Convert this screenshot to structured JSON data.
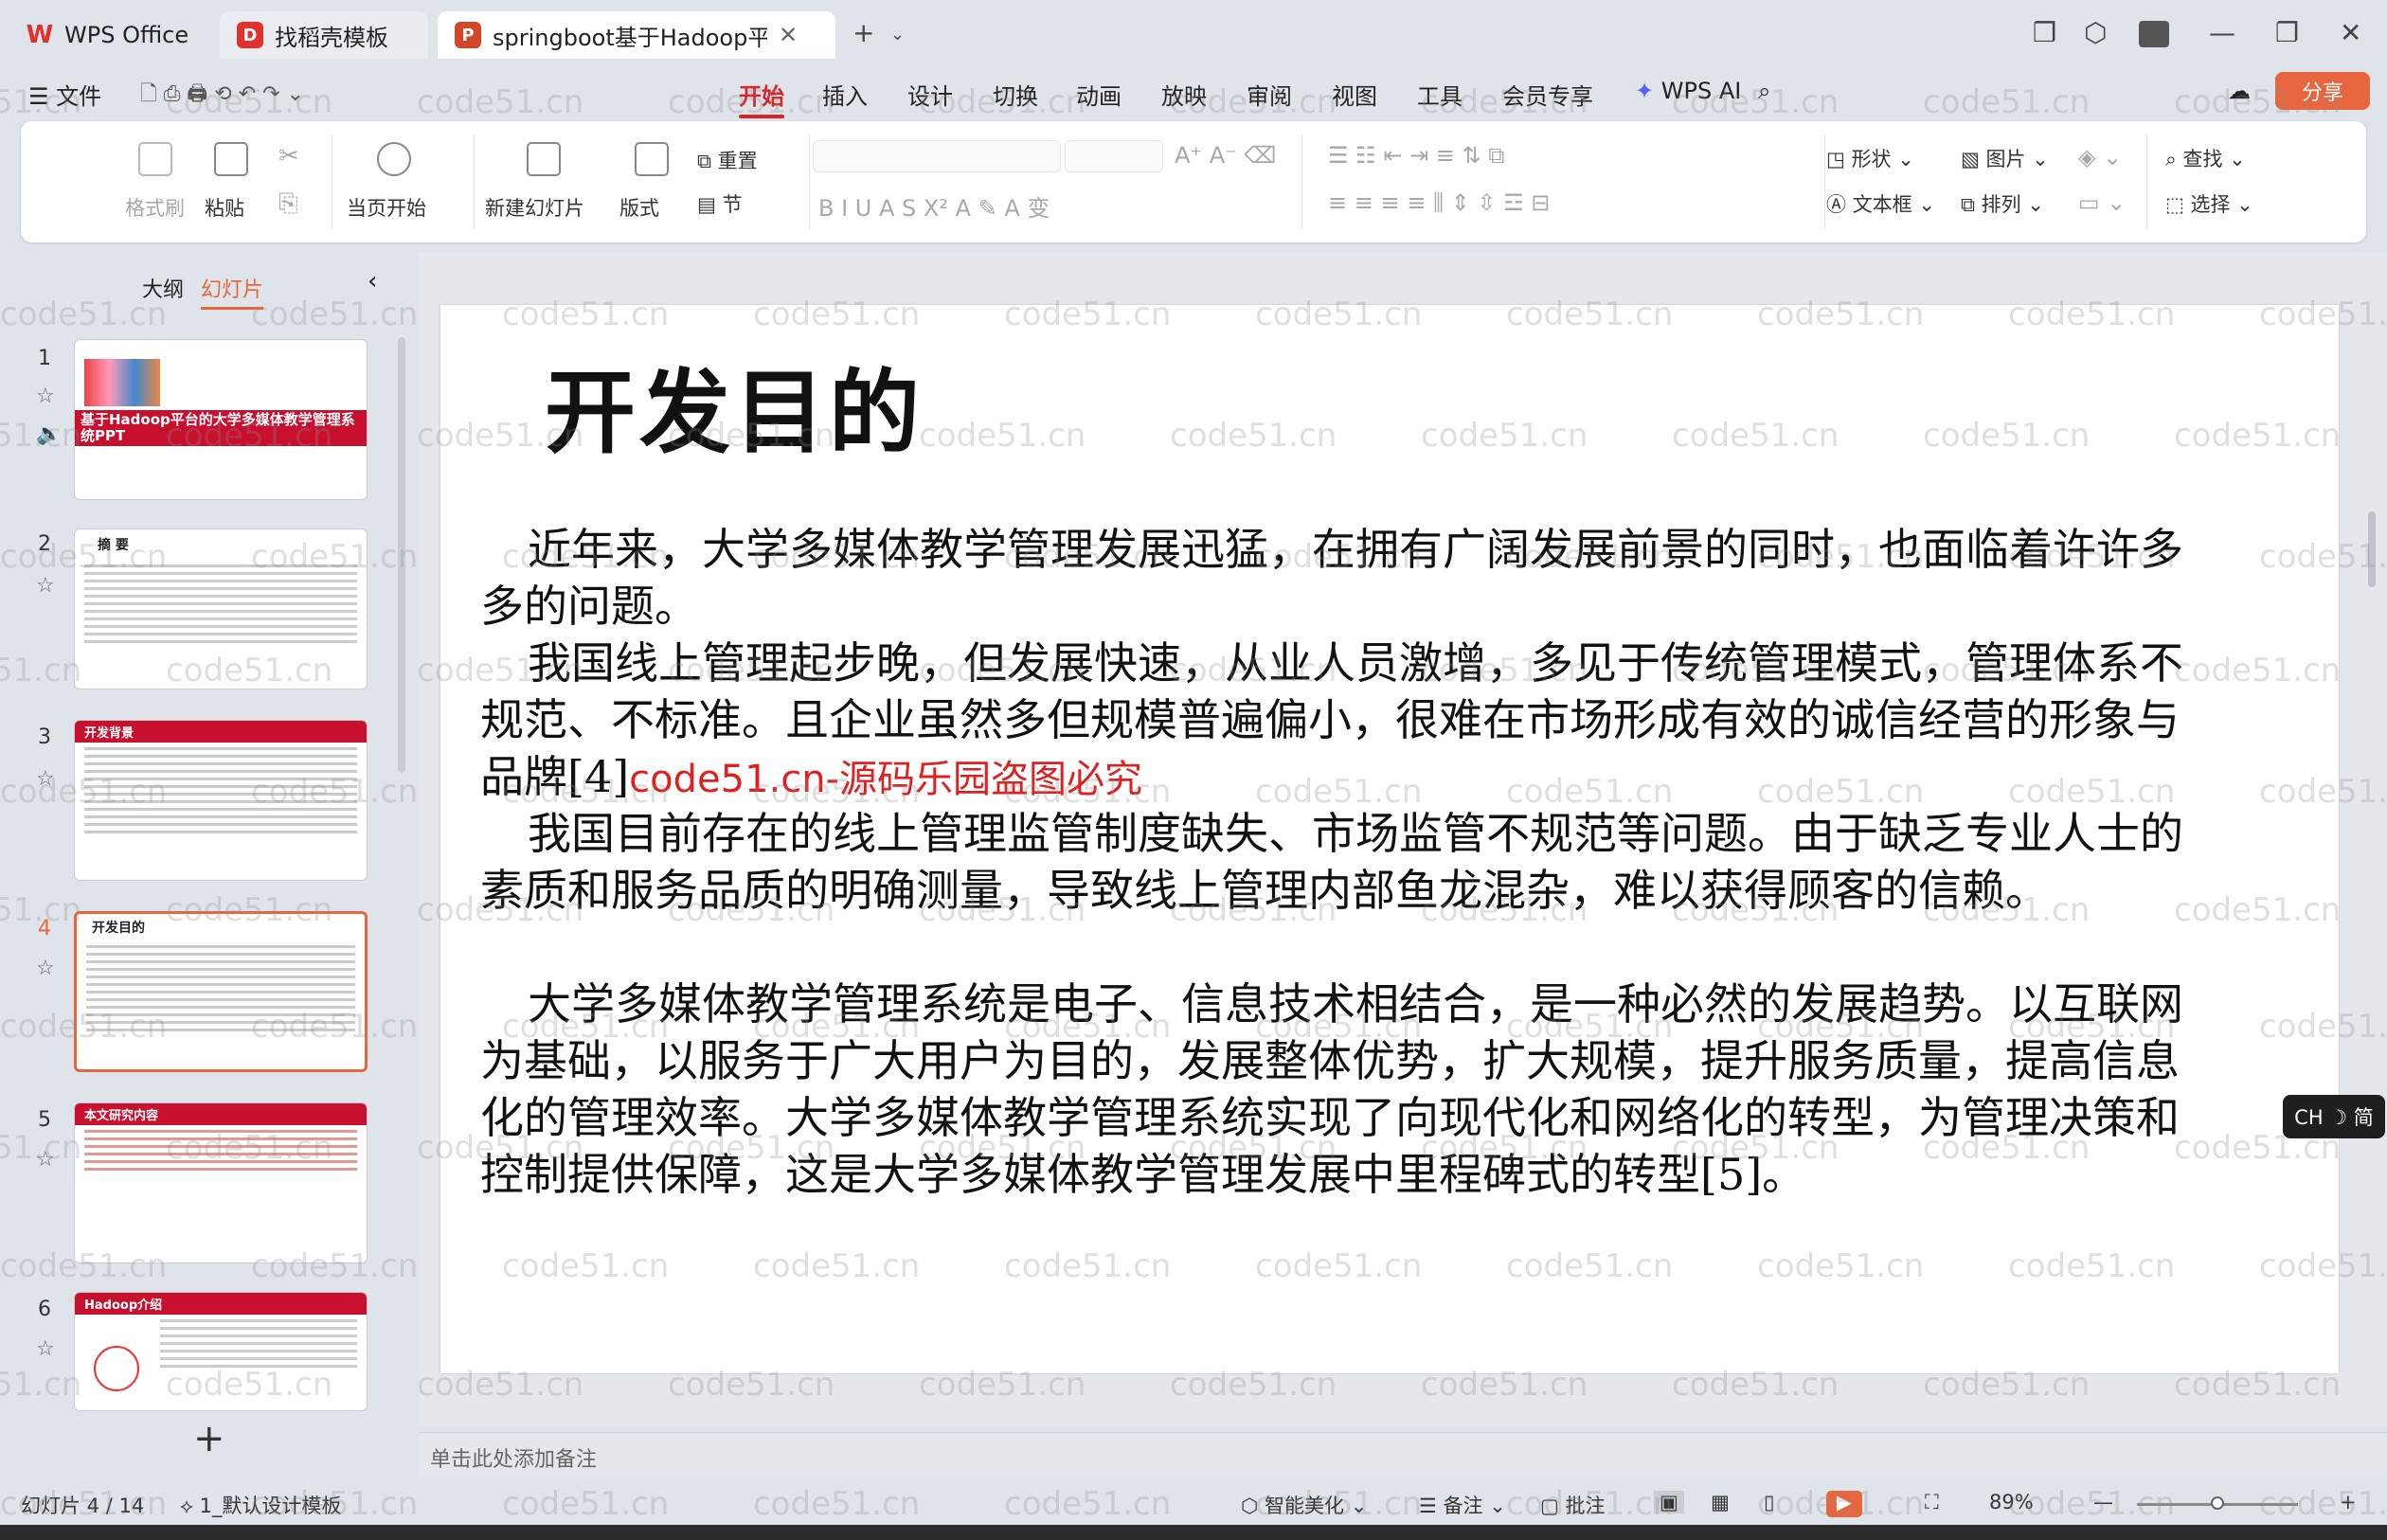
{
  "tabs": [
    {
      "label": "WPS Office",
      "icon": "wps-logo-icon",
      "color": "#e0312d"
    },
    {
      "label": "找稻壳模板",
      "icon": "docer-icon",
      "color": "#e0312d"
    },
    {
      "label": "springboot基于Hadoop平台的",
      "icon": "presentation-icon",
      "color": "#d24726"
    }
  ],
  "menu": {
    "file": "文件",
    "items": [
      "开始",
      "插入",
      "设计",
      "切换",
      "动画",
      "放映",
      "审阅",
      "视图",
      "工具",
      "会员专享"
    ],
    "active": "开始",
    "wps_ai": "WPS AI",
    "share": "分享"
  },
  "ribbon": {
    "format_painter": "格式刷",
    "paste": "粘贴",
    "from_current": "当页开始",
    "new_slide": "新建幻灯片",
    "layout": "版式",
    "reset": "重置",
    "section": "节",
    "shape": "形状",
    "picture": "图片",
    "find": "查找",
    "textbox": "文本框",
    "arrange": "排列",
    "select": "选择"
  },
  "panel": {
    "tab_outline": "大纲",
    "tab_slides": "幻灯片",
    "add": "+"
  },
  "thumbnails": [
    {
      "num": "1",
      "title": "基于Hadoop平台的大学多媒体教学管理系统PPT"
    },
    {
      "num": "2",
      "title": "摘 要"
    },
    {
      "num": "3",
      "title": "开发背景"
    },
    {
      "num": "4",
      "title": "开发目的"
    },
    {
      "num": "5",
      "title": "本文研究内容"
    },
    {
      "num": "6",
      "title": "Hadoop介绍"
    }
  ],
  "slide": {
    "title": "开发目的",
    "p1": "近年来，大学多媒体教学管理发展迅猛，在拥有广阔发展前景的同时，也面临着许许多多的问题。",
    "p2": "我国线上管理起步晚，但发展快速，从业人员激增，多见于传统管理模式，管理体系不规范、不标准。且企业虽然多但规模普遍偏小，很难在市场形成有效的诚信经营的形象与品牌[4]",
    "p2_watermark": "code51.cn-源码乐园盗图必究",
    "p3": "我国目前存在的线上管理监管制度缺失、市场监管不规范等问题。由于缺乏专业人士的素质和服务品质的明确测量，导致线上管理内部鱼龙混杂，难以获得顾客的信赖。",
    "p4": "大学多媒体教学管理系统是电子、信息技术相结合，是一种必然的发展趋势。以互联网为基础，以服务于广大用户为目的，发展整体优势，扩大规模，提升服务质量，提高信息化的管理效率。大学多媒体教学管理系统实现了向现代化和网络化的转型，为管理决策和控制提供保障，这是大学多媒体教学管理发展中里程碑式的转型[5]。"
  },
  "notes_placeholder": "单击此处添加备注",
  "status": {
    "slide_count": "幻灯片 4 / 14",
    "theme": "1_默认设计模板",
    "beautify": "智能美化",
    "notes": "备注",
    "comment": "批注",
    "zoom": "89%"
  },
  "ime": "CH ☽ 简",
  "watermark": "code51.cn",
  "colors": {
    "accent": "#d7252a",
    "selected_thumb": "#e8663e",
    "share_btn": "#e8663e"
  }
}
